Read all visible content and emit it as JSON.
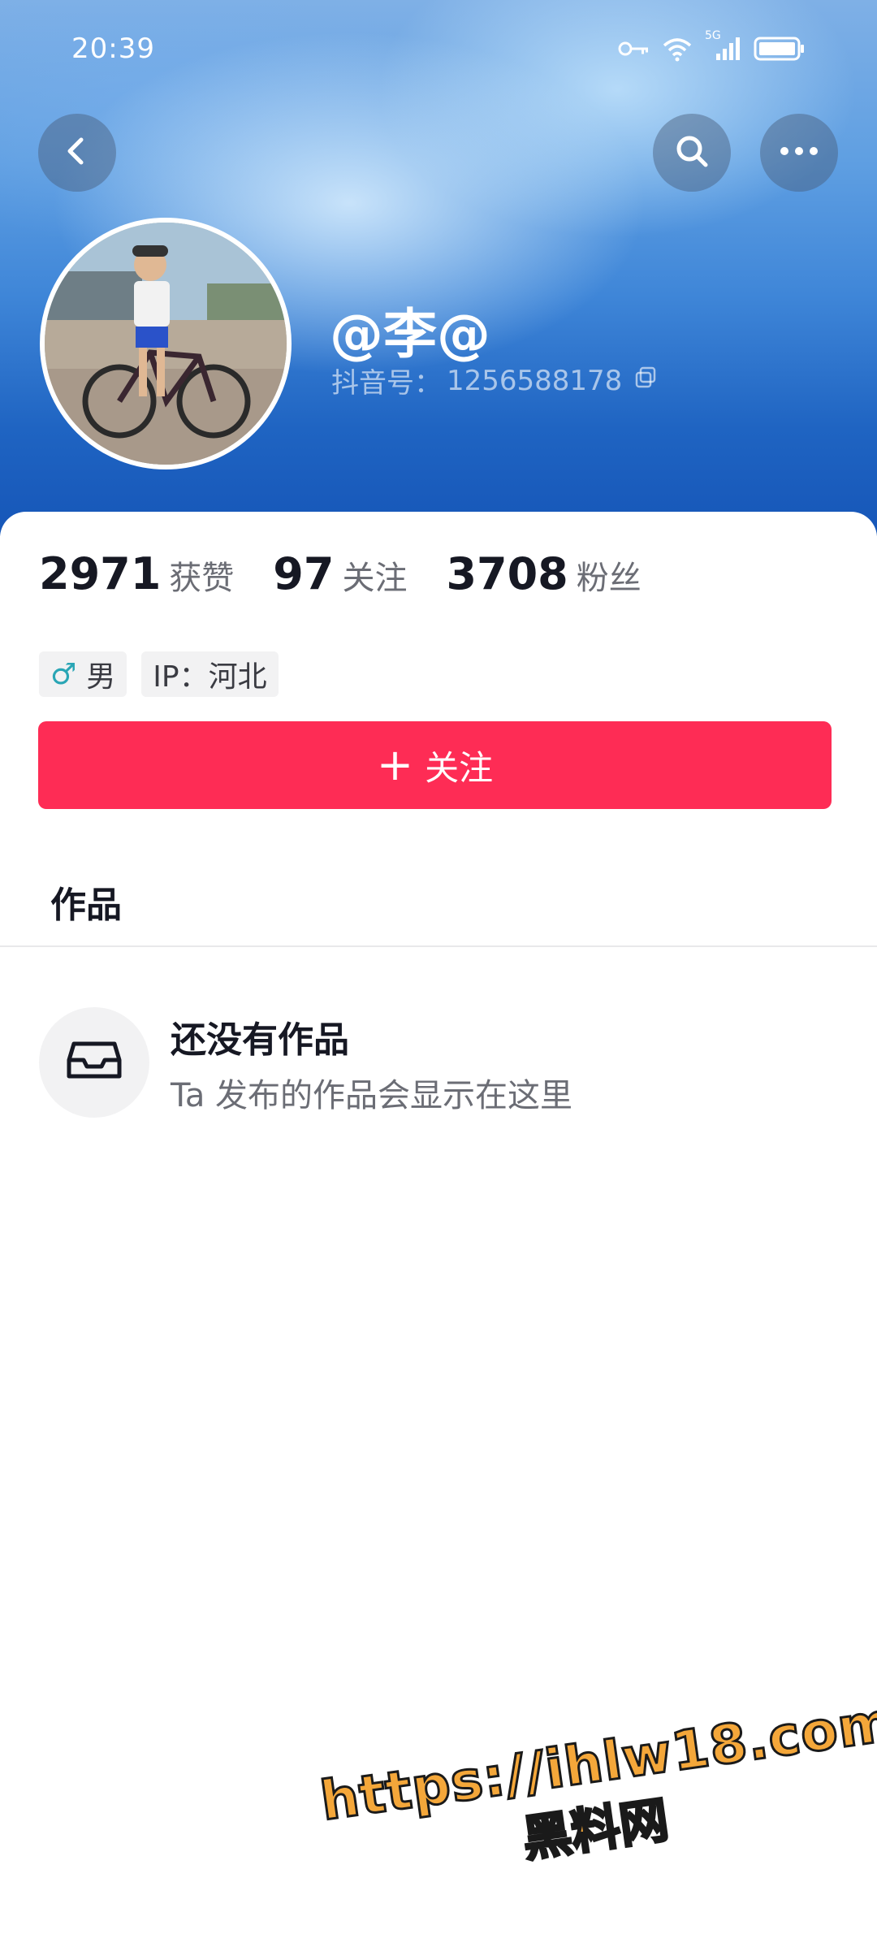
{
  "status_bar": {
    "time": "20:39",
    "network_label": "5G",
    "icons": [
      "key-icon",
      "wifi-icon",
      "signal-icon",
      "battery-icon"
    ]
  },
  "header": {
    "back_icon": "chevron-left-icon",
    "search_icon": "search-icon",
    "more_icon": "more-icon"
  },
  "profile": {
    "nickname": "@李@",
    "douyin_id_label": "抖音号：",
    "douyin_id": "1256588178",
    "avatar_desc": "avatar"
  },
  "stats": [
    {
      "value": "2971",
      "label": "获赞"
    },
    {
      "value": "97",
      "label": "关注"
    },
    {
      "value": "3708",
      "label": "粉丝"
    }
  ],
  "tags": {
    "gender_symbol": "♂",
    "gender": "男",
    "ip": "IP：河北"
  },
  "follow_button": {
    "plus": "+",
    "label": "关注"
  },
  "tabs": {
    "works": "作品"
  },
  "empty_state": {
    "title": "还没有作品",
    "subtitle": "Ta 发布的作品会显示在这里"
  },
  "watermark": {
    "url": "https://ihlw18.com",
    "name": "黑料网"
  },
  "colors": {
    "accent": "#fe2c55",
    "header_blue": "#1f64c2",
    "watermark": "#f4a73a"
  }
}
